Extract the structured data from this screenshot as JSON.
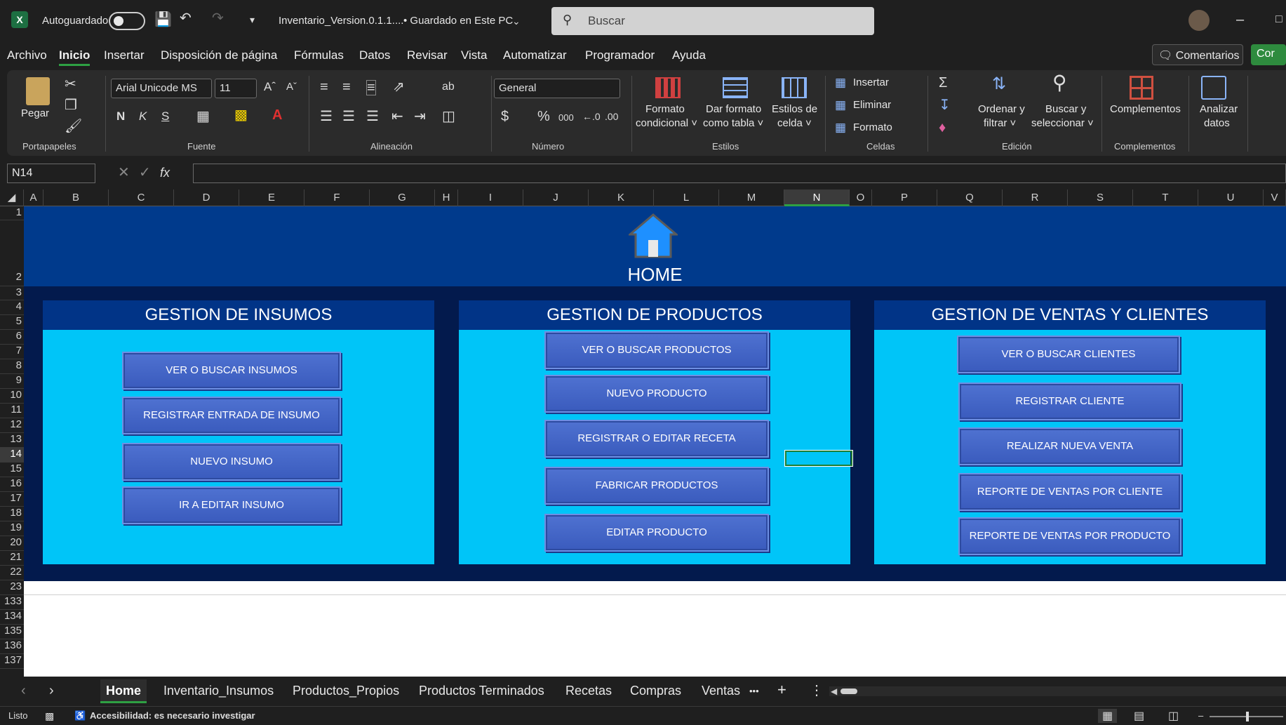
{
  "titlebar": {
    "autosave_label": "Autoguardado",
    "file_name": "Inventario_Version.0.1.1....",
    "save_status": "• Guardado en Este PC",
    "search_placeholder": "Buscar"
  },
  "menu": {
    "items": [
      "Archivo",
      "Inicio",
      "Insertar",
      "Disposición de página",
      "Fórmulas",
      "Datos",
      "Revisar",
      "Vista",
      "Automatizar",
      "Programador",
      "Ayuda"
    ],
    "active": "Inicio",
    "comments_label": "Comentarios",
    "share_label": "Cor"
  },
  "ribbon": {
    "clipboard": {
      "paste_label": "Pegar",
      "group_label": "Portapapeles"
    },
    "font": {
      "font_name": "Arial Unicode MS",
      "font_size": "11",
      "group_label": "Fuente",
      "bold": "N",
      "italic": "K",
      "underline": "S"
    },
    "alignment": {
      "group_label": "Alineación"
    },
    "number": {
      "format": "General",
      "group_label": "Número",
      "currency": "$",
      "percent": "%",
      "thousands": "000"
    },
    "styles": {
      "conditional": [
        "Formato",
        "condicional ˅"
      ],
      "as_table": [
        "Dar formato",
        "como tabla ˅"
      ],
      "cell_styles": [
        "Estilos de",
        "celda ˅"
      ],
      "group_label": "Estilos"
    },
    "cells": {
      "insert": "Insertar",
      "delete": "Eliminar",
      "format": "Formato",
      "group_label": "Celdas"
    },
    "editing": {
      "sort": [
        "Ordenar y",
        "filtrar ˅"
      ],
      "find": [
        "Buscar y",
        "seleccionar ˅"
      ],
      "group_label": "Edición"
    },
    "addins": {
      "label": "Complementos",
      "group_label": "Complementos"
    },
    "analyze": [
      "Analizar",
      "datos"
    ]
  },
  "formula_bar": {
    "name_box": "N14",
    "fx": "fx",
    "formula": ""
  },
  "columns": [
    "A",
    "B",
    "C",
    "D",
    "E",
    "F",
    "G",
    "H",
    "I",
    "J",
    "K",
    "L",
    "M",
    "N",
    "O",
    "P",
    "Q",
    "R",
    "S",
    "T",
    "U",
    "V"
  ],
  "selected_column": "N",
  "rows": [
    "1",
    "2",
    "3",
    "4",
    "5",
    "6",
    "7",
    "8",
    "9",
    "10",
    "11",
    "12",
    "13",
    "14",
    "15",
    "16",
    "17",
    "18",
    "19",
    "20",
    "21",
    "22",
    "23",
    "133",
    "134",
    "135",
    "136",
    "137"
  ],
  "selected_row": "14",
  "dashboard": {
    "home_title": "HOME",
    "panels": [
      {
        "title": "GESTION DE INSUMOS",
        "buttons": [
          "VER O BUSCAR INSUMOS",
          "REGISTRAR ENTRADA DE INSUMO",
          "NUEVO INSUMO",
          "IR A EDITAR INSUMO"
        ]
      },
      {
        "title": "GESTION DE PRODUCTOS",
        "buttons": [
          "VER O BUSCAR PRODUCTOS",
          "NUEVO PRODUCTO",
          "REGISTRAR O EDITAR RECETA",
          "FABRICAR PRODUCTOS",
          "EDITAR PRODUCTO"
        ]
      },
      {
        "title": "GESTION DE VENTAS Y CLIENTES",
        "buttons": [
          "VER O BUSCAR CLIENTES",
          "REGISTRAR CLIENTE",
          "REALIZAR NUEVA VENTA",
          "REPORTE DE VENTAS POR CLIENTE",
          "REPORTE DE VENTAS POR PRODUCTO"
        ]
      }
    ]
  },
  "sheet_tabs": {
    "tabs": [
      "Home",
      "Inventario_Insumos",
      "Productos_Propios",
      "Productos Terminados",
      "Recetas",
      "Compras",
      "Ventas"
    ],
    "active": "Home",
    "more": "•••",
    "add": "+"
  },
  "status_bar": {
    "ready": "Listo",
    "accessibility": "Accesibilidad: es necesario investigar"
  },
  "colors": {
    "home_band": "#003a8c",
    "dark_band": "#031a4d",
    "panel_bg": "#00c5f8",
    "panel_header": "#013487",
    "button": "#3f60c4",
    "accent_green": "#2ea043"
  }
}
